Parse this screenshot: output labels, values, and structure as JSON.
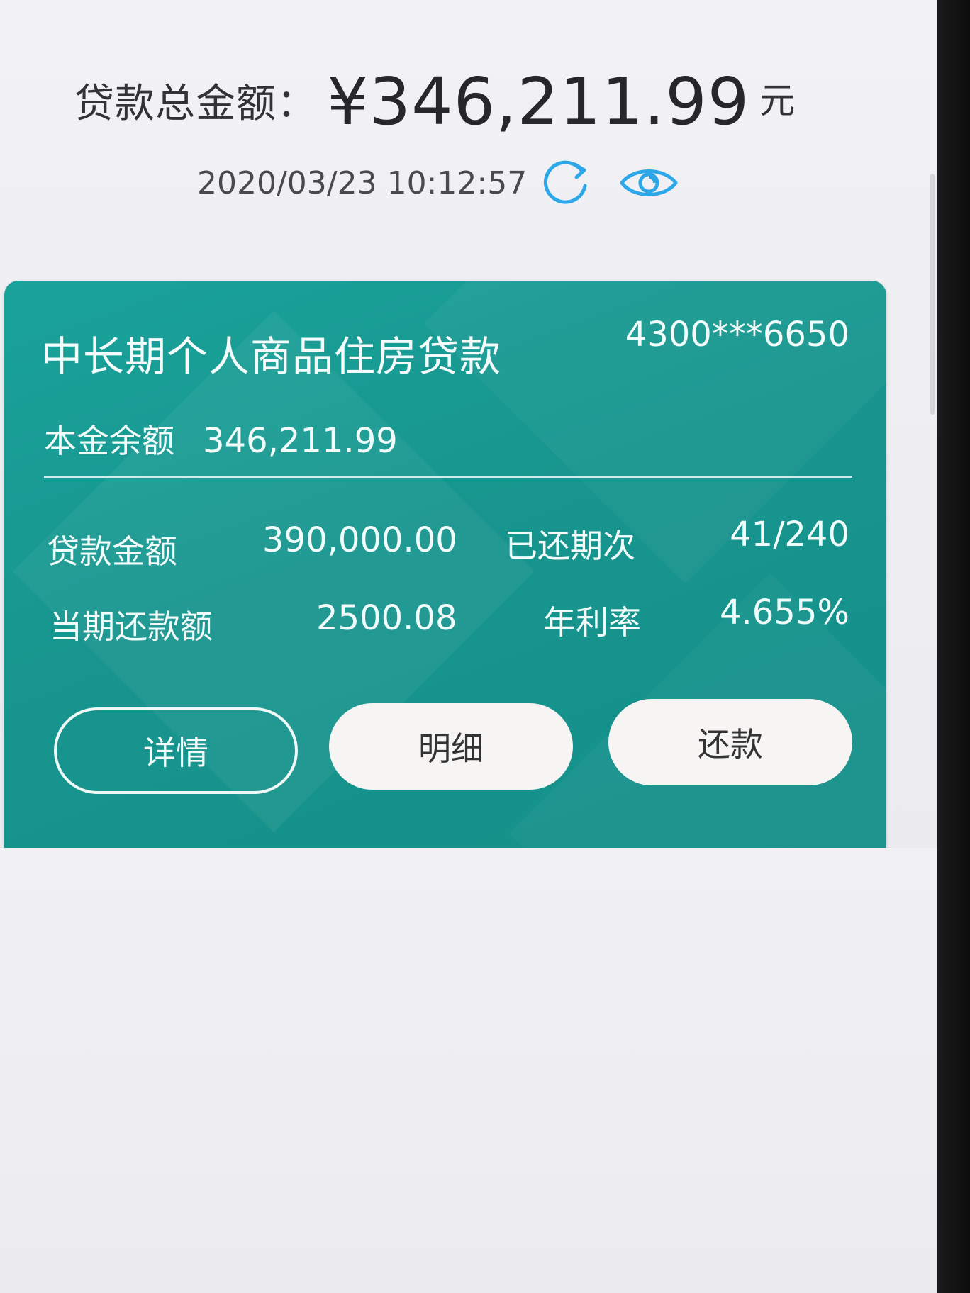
{
  "summary": {
    "total_label": "贷款总金额：",
    "total_amount": "¥346,211.99",
    "total_unit": "元",
    "timestamp": "2020/03/23 10:12:57",
    "refresh_icon": "refresh-icon",
    "visibility_icon": "eye-icon"
  },
  "loan_card": {
    "title": "中长期个人商品住房贷款",
    "account_number": "4300***6650",
    "principal_label": "本金余额",
    "principal_value": "346,211.99",
    "details": {
      "loan_amount_label": "贷款金额",
      "loan_amount_value": "390,000.00",
      "paid_periods_label": "已还期次",
      "paid_periods_value": "41/240",
      "current_payment_label": "当期还款额",
      "current_payment_value": "2500.08",
      "annual_rate_label": "年利率",
      "annual_rate_value": "4.655%"
    },
    "actions": {
      "detail_label": "详情",
      "statement_label": "明细",
      "repay_label": "还款"
    },
    "colors": {
      "card_background": "#17958e",
      "accent_blue": "#2ea7e8"
    }
  }
}
